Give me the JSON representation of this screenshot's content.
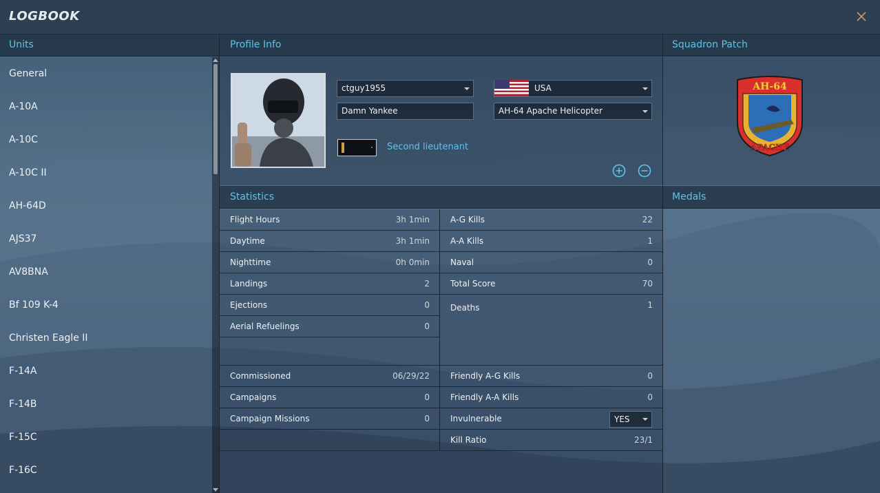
{
  "window": {
    "title": "LOGBOOK"
  },
  "units": {
    "header": "Units",
    "items": [
      "General",
      "A-10A",
      "A-10C",
      "A-10C II",
      "AH-64D",
      "AJS37",
      "AV8BNA",
      "Bf 109 K-4",
      "Christen Eagle II",
      "F-14A",
      "F-14B",
      "F-15C",
      "F-16C"
    ]
  },
  "profile": {
    "header": "Profile Info",
    "callsign": "ctguy1955",
    "name": "Damn Yankee",
    "country": "USA",
    "aircraft": "AH-64 Apache Helicopter",
    "rank": "Second lieutenant"
  },
  "squadron": {
    "header": "Squadron Patch",
    "patch_top": "AH-64",
    "patch_bottom": "APACHE"
  },
  "medals": {
    "header": "Medals"
  },
  "statistics": {
    "header": "Statistics",
    "left": [
      {
        "label": "Flight Hours",
        "value": "3h 1min"
      },
      {
        "label": "Daytime",
        "value": "3h 1min"
      },
      {
        "label": "Nighttime",
        "value": "0h 0min"
      },
      {
        "label": "Landings",
        "value": "2"
      },
      {
        "label": "Ejections",
        "value": "0"
      },
      {
        "label": "Aerial Refuelings",
        "value": "0"
      }
    ],
    "right": [
      {
        "label": "A-G Kills",
        "value": "22"
      },
      {
        "label": "A-A Kills",
        "value": "1"
      },
      {
        "label": "Naval",
        "value": "0"
      },
      {
        "label": "Total Score",
        "value": "70"
      },
      {
        "label": "Deaths",
        "value": "1"
      }
    ],
    "left_bottom": [
      {
        "label": "Commissioned",
        "value": "06/29/22"
      },
      {
        "label": "Campaigns",
        "value": "0"
      },
      {
        "label": "Campaign Missions",
        "value": "0"
      }
    ],
    "right_bottom": [
      {
        "label": "Friendly A-G Kills",
        "value": "0"
      },
      {
        "label": "Friendly A-A Kills",
        "value": "0"
      },
      {
        "label": "Invulnerable",
        "value": "YES"
      },
      {
        "label": "Kill Ratio",
        "value": "23/1"
      }
    ]
  },
  "colors": {
    "accent": "#5fc3ea",
    "background": "#3a5068"
  }
}
